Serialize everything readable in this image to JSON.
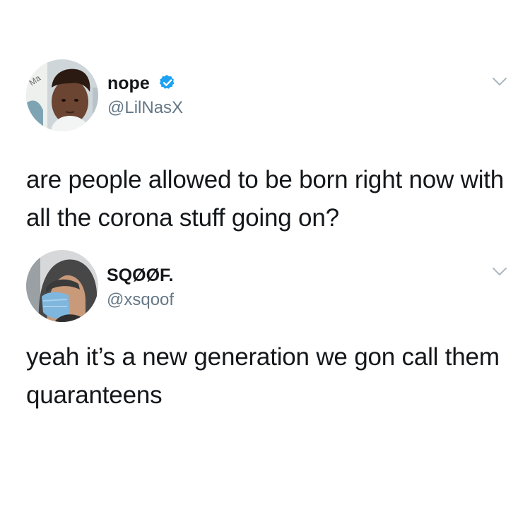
{
  "tweets": [
    {
      "display_name": "nope",
      "verified": true,
      "handle": "@LilNasX",
      "text": "are people allowed to be born right now with all the corona stuff going on?",
      "avatar_text": "Ma"
    },
    {
      "display_name": "SQØØF.",
      "verified": false,
      "handle": "@xsqoof",
      "text": "yeah it’s a new generation we gon call them quaranteens"
    }
  ],
  "colors": {
    "text": "#14171a",
    "handle": "#657786",
    "verified": "#1da1f2",
    "chevron": "#aab8c2"
  },
  "icons": {
    "verified": "verified-badge-icon",
    "more": "chevron-down-icon"
  }
}
